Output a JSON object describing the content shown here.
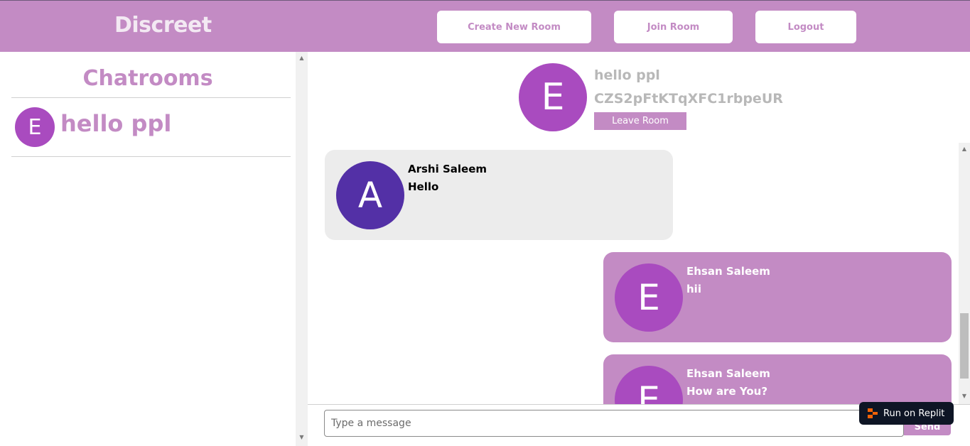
{
  "header": {
    "brand": "Discreet",
    "buttons": {
      "create_room": "Create New Room",
      "join_room": "Join Room",
      "logout": "Logout"
    }
  },
  "sidebar": {
    "title": "Chatrooms",
    "rooms": [
      {
        "avatar_letter": "E",
        "name": "hello ppl"
      }
    ]
  },
  "room": {
    "avatar_letter": "E",
    "name": "hello ppl",
    "id": "CZS2pFtKTqXFC1rbpeUR",
    "leave_label": "Leave Room"
  },
  "messages": [
    {
      "side": "left",
      "avatar_letter": "A",
      "sender": "Arshi Saleem",
      "text": "Hello"
    },
    {
      "side": "right",
      "avatar_letter": "E",
      "sender": "Ehsan Saleem",
      "text": "hii"
    },
    {
      "side": "right",
      "avatar_letter": "E",
      "sender": "Ehsan Saleem",
      "text": "How are You?"
    }
  ],
  "composer": {
    "placeholder": "Type a message",
    "value": "",
    "send_label": "Send"
  },
  "replit_badge": {
    "label": "Run on Replit"
  },
  "colors": {
    "accent": "#c38bc4",
    "avatar_e": "#a94bbf",
    "avatar_a": "#5330a6",
    "other_bubble": "#ececec"
  }
}
